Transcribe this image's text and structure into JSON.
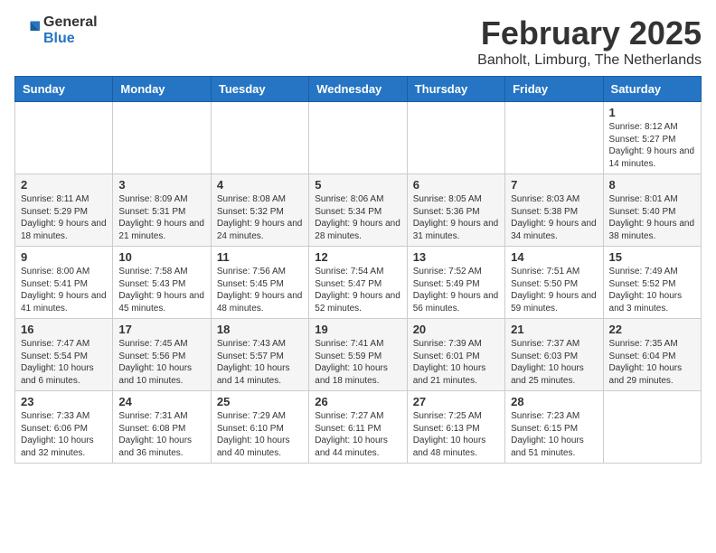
{
  "header": {
    "logo_general": "General",
    "logo_blue": "Blue",
    "month_title": "February 2025",
    "location": "Banholt, Limburg, The Netherlands"
  },
  "weekdays": [
    "Sunday",
    "Monday",
    "Tuesday",
    "Wednesday",
    "Thursday",
    "Friday",
    "Saturday"
  ],
  "weeks": [
    [
      {
        "day": "",
        "info": ""
      },
      {
        "day": "",
        "info": ""
      },
      {
        "day": "",
        "info": ""
      },
      {
        "day": "",
        "info": ""
      },
      {
        "day": "",
        "info": ""
      },
      {
        "day": "",
        "info": ""
      },
      {
        "day": "1",
        "info": "Sunrise: 8:12 AM\nSunset: 5:27 PM\nDaylight: 9 hours and 14 minutes."
      }
    ],
    [
      {
        "day": "2",
        "info": "Sunrise: 8:11 AM\nSunset: 5:29 PM\nDaylight: 9 hours and 18 minutes."
      },
      {
        "day": "3",
        "info": "Sunrise: 8:09 AM\nSunset: 5:31 PM\nDaylight: 9 hours and 21 minutes."
      },
      {
        "day": "4",
        "info": "Sunrise: 8:08 AM\nSunset: 5:32 PM\nDaylight: 9 hours and 24 minutes."
      },
      {
        "day": "5",
        "info": "Sunrise: 8:06 AM\nSunset: 5:34 PM\nDaylight: 9 hours and 28 minutes."
      },
      {
        "day": "6",
        "info": "Sunrise: 8:05 AM\nSunset: 5:36 PM\nDaylight: 9 hours and 31 minutes."
      },
      {
        "day": "7",
        "info": "Sunrise: 8:03 AM\nSunset: 5:38 PM\nDaylight: 9 hours and 34 minutes."
      },
      {
        "day": "8",
        "info": "Sunrise: 8:01 AM\nSunset: 5:40 PM\nDaylight: 9 hours and 38 minutes."
      }
    ],
    [
      {
        "day": "9",
        "info": "Sunrise: 8:00 AM\nSunset: 5:41 PM\nDaylight: 9 hours and 41 minutes."
      },
      {
        "day": "10",
        "info": "Sunrise: 7:58 AM\nSunset: 5:43 PM\nDaylight: 9 hours and 45 minutes."
      },
      {
        "day": "11",
        "info": "Sunrise: 7:56 AM\nSunset: 5:45 PM\nDaylight: 9 hours and 48 minutes."
      },
      {
        "day": "12",
        "info": "Sunrise: 7:54 AM\nSunset: 5:47 PM\nDaylight: 9 hours and 52 minutes."
      },
      {
        "day": "13",
        "info": "Sunrise: 7:52 AM\nSunset: 5:49 PM\nDaylight: 9 hours and 56 minutes."
      },
      {
        "day": "14",
        "info": "Sunrise: 7:51 AM\nSunset: 5:50 PM\nDaylight: 9 hours and 59 minutes."
      },
      {
        "day": "15",
        "info": "Sunrise: 7:49 AM\nSunset: 5:52 PM\nDaylight: 10 hours and 3 minutes."
      }
    ],
    [
      {
        "day": "16",
        "info": "Sunrise: 7:47 AM\nSunset: 5:54 PM\nDaylight: 10 hours and 6 minutes."
      },
      {
        "day": "17",
        "info": "Sunrise: 7:45 AM\nSunset: 5:56 PM\nDaylight: 10 hours and 10 minutes."
      },
      {
        "day": "18",
        "info": "Sunrise: 7:43 AM\nSunset: 5:57 PM\nDaylight: 10 hours and 14 minutes."
      },
      {
        "day": "19",
        "info": "Sunrise: 7:41 AM\nSunset: 5:59 PM\nDaylight: 10 hours and 18 minutes."
      },
      {
        "day": "20",
        "info": "Sunrise: 7:39 AM\nSunset: 6:01 PM\nDaylight: 10 hours and 21 minutes."
      },
      {
        "day": "21",
        "info": "Sunrise: 7:37 AM\nSunset: 6:03 PM\nDaylight: 10 hours and 25 minutes."
      },
      {
        "day": "22",
        "info": "Sunrise: 7:35 AM\nSunset: 6:04 PM\nDaylight: 10 hours and 29 minutes."
      }
    ],
    [
      {
        "day": "23",
        "info": "Sunrise: 7:33 AM\nSunset: 6:06 PM\nDaylight: 10 hours and 32 minutes."
      },
      {
        "day": "24",
        "info": "Sunrise: 7:31 AM\nSunset: 6:08 PM\nDaylight: 10 hours and 36 minutes."
      },
      {
        "day": "25",
        "info": "Sunrise: 7:29 AM\nSunset: 6:10 PM\nDaylight: 10 hours and 40 minutes."
      },
      {
        "day": "26",
        "info": "Sunrise: 7:27 AM\nSunset: 6:11 PM\nDaylight: 10 hours and 44 minutes."
      },
      {
        "day": "27",
        "info": "Sunrise: 7:25 AM\nSunset: 6:13 PM\nDaylight: 10 hours and 48 minutes."
      },
      {
        "day": "28",
        "info": "Sunrise: 7:23 AM\nSunset: 6:15 PM\nDaylight: 10 hours and 51 minutes."
      },
      {
        "day": "",
        "info": ""
      }
    ]
  ]
}
